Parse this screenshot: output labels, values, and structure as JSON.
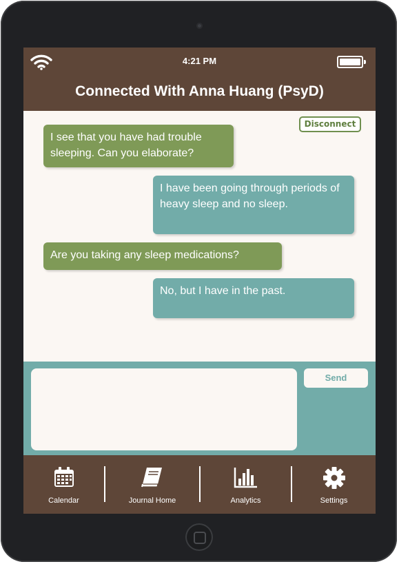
{
  "status_bar": {
    "time": "4:21 PM",
    "wifi_icon": "wifi-icon",
    "battery_icon": "battery-full-icon"
  },
  "header": {
    "title": "Connected With Anna Huang (PsyD)"
  },
  "chat": {
    "disconnect_label": "Disconnect",
    "messages": [
      {
        "from": "therapist",
        "text": "I see that you have had trouble sleeping. Can you elaborate?"
      },
      {
        "from": "user",
        "text": "I have been going through periods of heavy sleep and no sleep."
      },
      {
        "from": "therapist",
        "text": "Are you taking any sleep medications?"
      },
      {
        "from": "user",
        "text": "No, but I have in the past."
      }
    ]
  },
  "composer": {
    "input_value": "",
    "send_label": "Send"
  },
  "tab_bar": {
    "items": [
      {
        "label": "Calendar",
        "icon": "calendar-icon"
      },
      {
        "label": "Journal Home",
        "icon": "journal-icon"
      },
      {
        "label": "Analytics",
        "icon": "bar-chart-icon"
      },
      {
        "label": "Settings",
        "icon": "gear-icon"
      }
    ]
  },
  "colors": {
    "header_brown": "#5e4638",
    "therapist_bubble": "#7f9a57",
    "user_bubble": "#72aca9",
    "background_cream": "#fbf7f3",
    "device_frame": "#202124"
  }
}
